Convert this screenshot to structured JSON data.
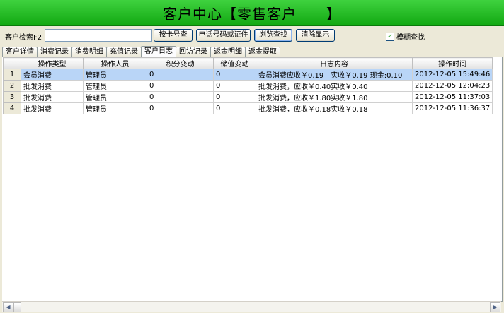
{
  "header": {
    "title": "客户中心【零售客户　　】"
  },
  "search": {
    "label": "客户检索F2",
    "value": "",
    "buttons": {
      "card": "按卡号查",
      "phone": "电话号码或证件",
      "browse": "浏览查找",
      "clear": "清除显示"
    },
    "fuzzy_label": "模糊查找",
    "fuzzy_checked": "✓"
  },
  "tabs": [
    "客户详情",
    "消费记录",
    "消费明细",
    "充值记录",
    "客户日志",
    "回访记录",
    "返金明细",
    "返金提取"
  ],
  "table": {
    "columns": [
      "",
      "操作类型",
      "操作人员",
      "积分变动",
      "储值变动",
      "日志内容",
      "操作时间"
    ],
    "rows": [
      [
        "1",
        "会员消费",
        "管理员",
        "0",
        "0",
        "会员消费应收￥0.19　实收￥0.19 现金:0.10",
        "2012-12-05 15:49:46"
      ],
      [
        "2",
        "批发消费",
        "管理员",
        "0",
        "0",
        "批发消费，应收￥0.40实收￥0.40",
        "2012-12-05 12:04:23"
      ],
      [
        "3",
        "批发消费",
        "管理员",
        "0",
        "0",
        "批发消费，应收￥1.80实收￥1.80",
        "2012-12-05 11:37:03"
      ],
      [
        "4",
        "批发消费",
        "管理员",
        "0",
        "0",
        "批发消费，应收￥0.18实收￥0.18",
        "2012-12-05 11:36:37"
      ]
    ]
  },
  "scrollbar": {
    "left_arrow": "◀",
    "right_arrow": "▶"
  },
  "colors": {
    "banner": "#1cb51c",
    "selected_row": "#b9d5f7"
  }
}
